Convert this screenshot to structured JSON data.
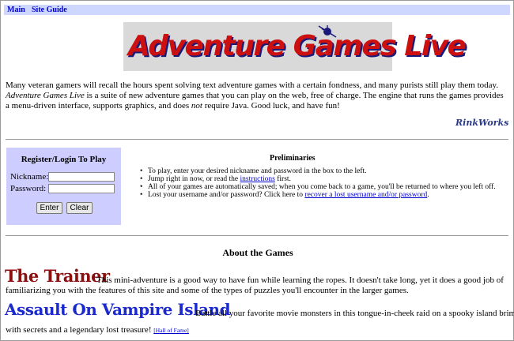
{
  "nav": {
    "items": [
      {
        "label": "Main"
      },
      {
        "label": "Site Guide"
      }
    ]
  },
  "banner": {
    "title": "Adventure Games Live"
  },
  "intro": {
    "text_1": "Many veteran gamers will recall the hours spent solving text adventure games with a certain fondness, and many purists still play them today. ",
    "title_italic": "Adventure Games Live",
    "text_2": " is a suite of new adventure games that you can play on the web, free of charge. The engine that runs the games provides a menu-driven interface, supports graphics, and does ",
    "not_italic": "not",
    "text_3": " require Java. Good luck, and have fun!"
  },
  "signature": "RinkWorks",
  "login": {
    "title": "Register/Login To Play",
    "nickname_label": "Nickname:",
    "password_label": "Password:",
    "nickname_value": "",
    "password_value": "",
    "enter_label": "Enter",
    "clear_label": "Clear"
  },
  "preliminaries": {
    "title": "Preliminaries",
    "item1": "To play, enter your desired nickname and password in the box to the left.",
    "item2_pre": "Jump right in now, or read the ",
    "item2_link": "instructions",
    "item2_post": " first.",
    "item3": "All of your games are automatically saved; when you come back to a game, you'll be returned to where you left off.",
    "item4_pre": "Lost your username and/or password? Click here to ",
    "item4_link": "recover a lost username and/or password",
    "item4_post": "."
  },
  "about": {
    "title": "About the Games",
    "games": [
      {
        "title": "The Trainer",
        "line1": "This mini-adventure is a good way to have fun while learning the ropes. It doesn't take long, yet it does a good job of",
        "line2": "familiarizing you with the features of this site and some of the types of puzzles you'll encounter in the larger games."
      },
      {
        "title": "Assault On Vampire Island",
        "line1": "Battle all your favorite movie monsters in this tongue-in-cheek raid on a spooky island brimming",
        "line2": "with secrets and a legendary lost treasure! ",
        "hall_of_fame": "[Hall of Fame]"
      }
    ]
  }
}
